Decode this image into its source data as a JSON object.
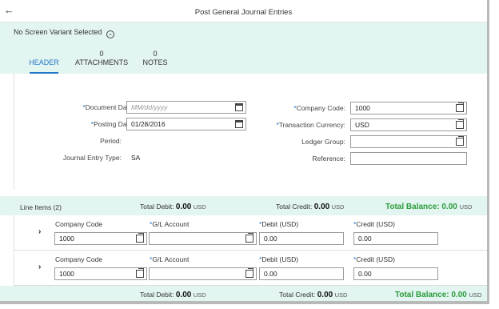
{
  "window": {
    "title": "Post General Journal Entries"
  },
  "header": {
    "variant_label": "No Screen Variant Selected",
    "tabs": [
      {
        "label": "HEADER",
        "count": ""
      },
      {
        "label": "ATTACHMENTS",
        "count": "0"
      },
      {
        "label": "NOTES",
        "count": "0"
      }
    ]
  },
  "form": {
    "document_date": {
      "label": "Document Date:",
      "placeholder": "MM/dd/yyyy",
      "required": "*"
    },
    "posting_date": {
      "label": "Posting Date:",
      "value": "01/28/2016",
      "required": "*"
    },
    "period": {
      "label": "Period:"
    },
    "journal_entry_type": {
      "label": "Journal Entry Type:",
      "value": "SA"
    },
    "company_code": {
      "label": "Company Code:",
      "value": "1000",
      "required": "*"
    },
    "transaction_currency": {
      "label": "Transaction Currency:",
      "value": "USD",
      "required": "*"
    },
    "ledger_group": {
      "label": "Ledger Group:",
      "value": ""
    },
    "reference": {
      "label": "Reference:",
      "value": ""
    }
  },
  "line_items": {
    "title": "Line Items (2)",
    "total_debit_label": "Total Debit:",
    "total_debit_value": "0.00",
    "total_credit_label": "Total Credit:",
    "total_credit_value": "0.00",
    "total_balance_label": "Total Balance:",
    "total_balance_value": "0.00",
    "currency": "USD",
    "columns": {
      "company_code": "Company Code",
      "gl_account": "G/L Account",
      "debit": "Debit (USD)",
      "credit": "Credit (USD)",
      "required": "*"
    },
    "rows": [
      {
        "company_code": "1000",
        "gl_account": "",
        "debit": "0.00",
        "credit": "0.00"
      },
      {
        "company_code": "1000",
        "gl_account": "",
        "debit": "0.00",
        "credit": "0.00"
      }
    ]
  },
  "footer": {
    "total_debit_label": "Total Debit:",
    "total_debit_value": "0.00",
    "total_credit_label": "Total Credit:",
    "total_credit_value": "0.00",
    "total_balance_label": "Total Balance:",
    "total_balance_value": "0.00",
    "currency": "USD"
  },
  "colors": {
    "accent": "#1f75c8",
    "header_bg": "#e3f5f1",
    "balance_green": "#2a9c3a"
  }
}
